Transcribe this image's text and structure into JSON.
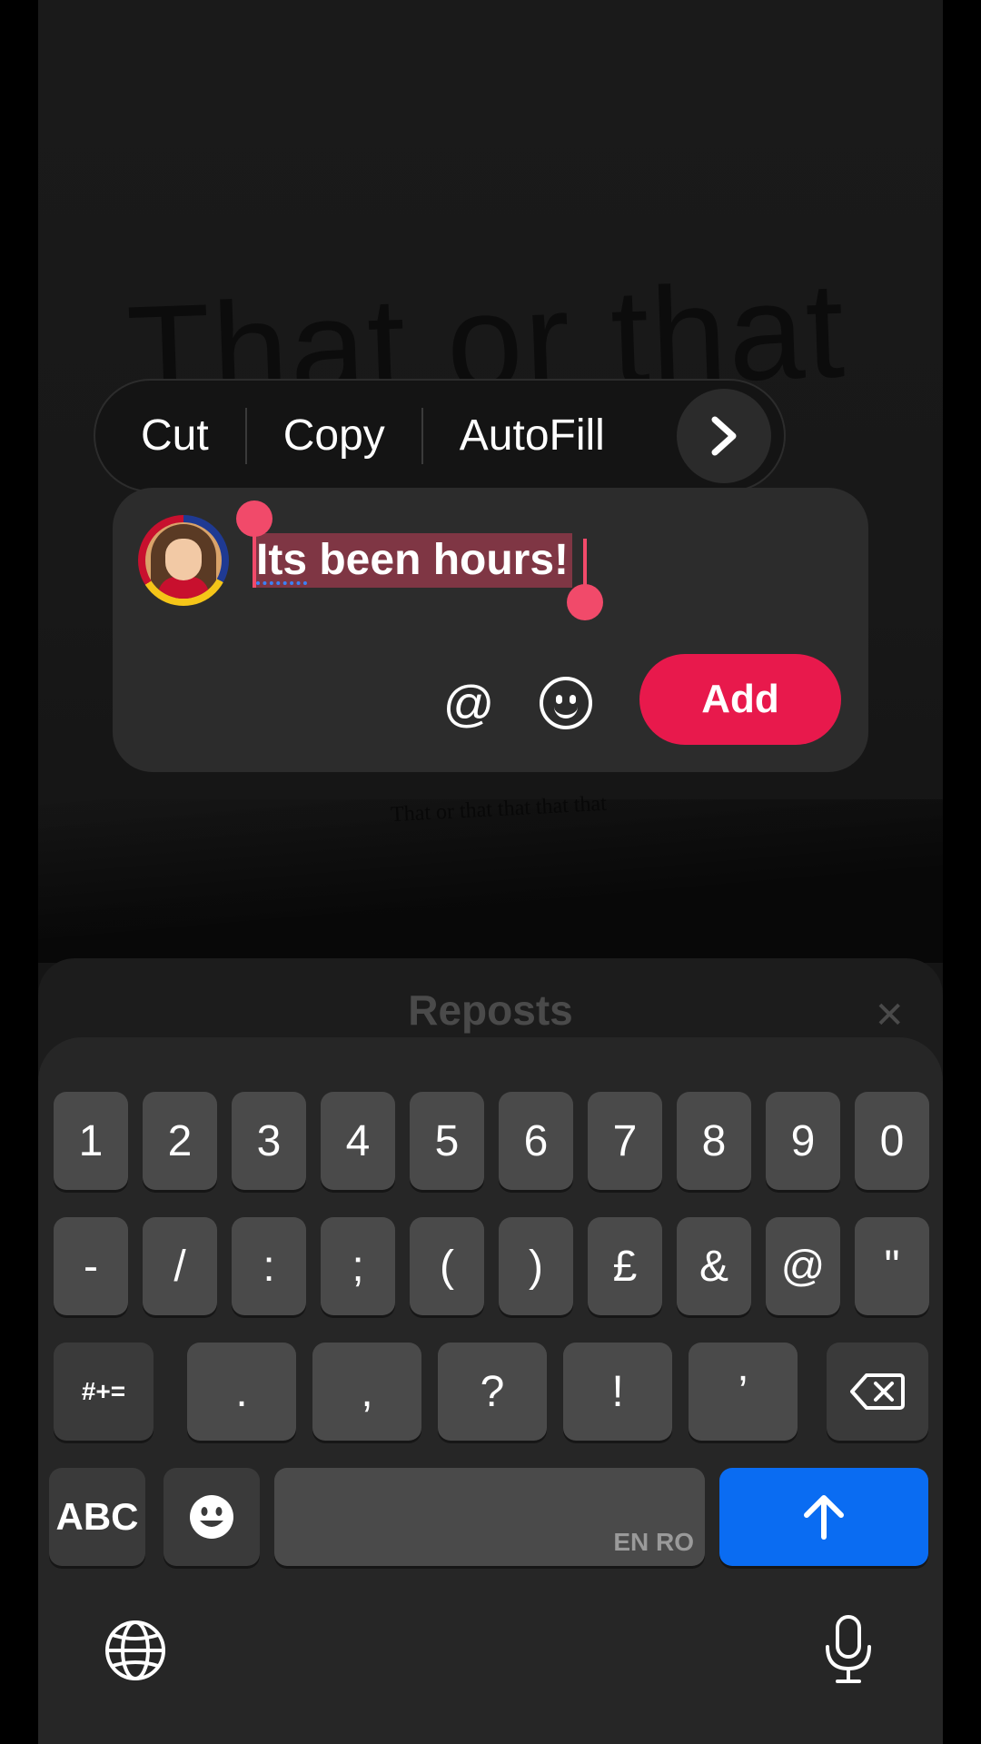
{
  "background": {
    "large_text": "That or that",
    "small_text": "That or that that that that"
  },
  "context_menu": {
    "items": [
      "Cut",
      "Copy",
      "AutoFill"
    ],
    "more_icon": "chevron-right-icon"
  },
  "comment": {
    "text": "Its been hours!",
    "mention_label": "@",
    "emoji_icon": "smiley-icon",
    "add_label": "Add",
    "accent_color": "#e8194c"
  },
  "sheet": {
    "title": "Reposts",
    "close_label": "✕"
  },
  "keyboard": {
    "row1": [
      "1",
      "2",
      "3",
      "4",
      "5",
      "6",
      "7",
      "8",
      "9",
      "0"
    ],
    "row2": [
      "-",
      "/",
      ":",
      ";",
      "(",
      ")",
      "£",
      "&",
      "@",
      "\""
    ],
    "row3": [
      "#+=",
      ".",
      ",",
      "?",
      "!",
      "’"
    ],
    "abc_label": "ABC",
    "space_lang": "EN RO",
    "delete_icon": "backspace-icon",
    "send_icon": "arrow-up-icon",
    "emoji_icon": "emoji-keyboard-icon",
    "globe_icon": "globe-icon",
    "mic_icon": "microphone-icon",
    "send_color": "#0a6cf2"
  }
}
